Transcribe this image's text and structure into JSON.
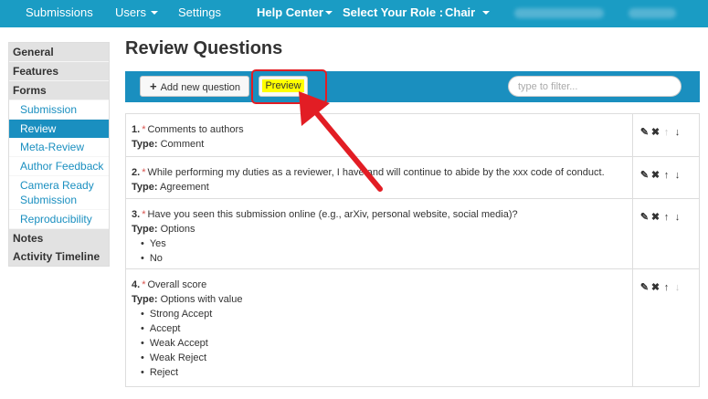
{
  "topnav": {
    "submissions": "Submissions",
    "users": "Users",
    "settings": "Settings",
    "help_center": "Help Center",
    "select_role": "Select Your Role :",
    "role": "Chair"
  },
  "sidebar": {
    "general": "General",
    "features": "Features",
    "forms": "Forms",
    "submission": "Submission",
    "review": "Review",
    "meta_review": "Meta-Review",
    "author_feedback": "Author Feedback",
    "camera_ready_1": "Camera Ready",
    "camera_ready_2": "Submission",
    "reproducibility": "Reproducibility",
    "notes": "Notes",
    "activity_timeline": "Activity Timeline"
  },
  "main": {
    "title": "Review Questions",
    "add_button": "Add new question",
    "preview_button": "Preview",
    "filter_placeholder": "type to filter..."
  },
  "questions": [
    {
      "num": "1.",
      "text": "Comments to authors",
      "type_label": "Type:",
      "type": "Comment",
      "options": []
    },
    {
      "num": "2.",
      "text": "While performing my duties as a reviewer, I have and will continue to abide by the xxx code of conduct.",
      "type_label": "Type:",
      "type": "Agreement",
      "options": []
    },
    {
      "num": "3.",
      "text": "Have you seen this submission online (e.g., arXiv, personal website, social media)?",
      "type_label": "Type:",
      "type": "Options",
      "options": [
        "Yes",
        "No"
      ]
    },
    {
      "num": "4.",
      "text": "Overall score",
      "type_label": "Type:",
      "type": "Options with value",
      "options": [
        "Strong Accept",
        "Accept",
        "Weak Accept",
        "Weak Reject",
        "Reject"
      ]
    }
  ],
  "icons": {
    "edit": "edit-icon",
    "delete": "delete-icon",
    "up": "arrow-up-icon",
    "down": "arrow-down-icon"
  },
  "colors": {
    "nav": "#1a9cc4",
    "toolbar": "#1a8fbf",
    "active_sidebar": "#1a8fc0",
    "highlight": "#ffff00",
    "annotation": "#e21d24",
    "required": "#d9534f"
  }
}
